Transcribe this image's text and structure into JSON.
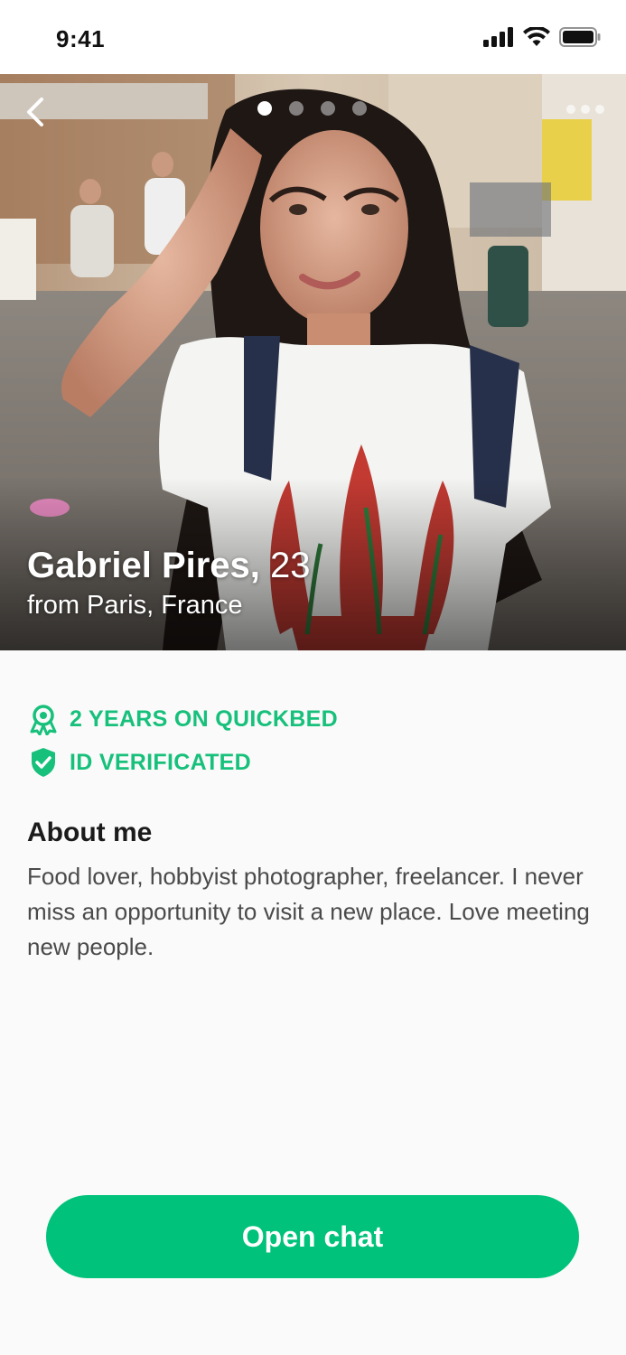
{
  "status_bar": {
    "time": "9:41",
    "icons": [
      "cellular-signal-icon",
      "wifi-icon",
      "battery-icon"
    ]
  },
  "photo": {
    "description_icon": "profile-photo",
    "pages_total": 4,
    "page_current": 1
  },
  "profile": {
    "name": "Gabriel Pires,",
    "age": "23",
    "location": "from Paris, France"
  },
  "badges": [
    {
      "icon": "award-ribbon-icon",
      "label": "2 YEARS ON QUICKBED"
    },
    {
      "icon": "shield-check-icon",
      "label": "ID VERIFICATED"
    }
  ],
  "about": {
    "title": "About me",
    "text": "Food lover, hobbyist photographer, freelancer. I never miss an opportunity to visit a new place. Love meeting new people."
  },
  "actions": {
    "open_chat_label": "Open chat"
  },
  "colors": {
    "accent": "#00c27a",
    "badge_text": "#17c07b"
  }
}
